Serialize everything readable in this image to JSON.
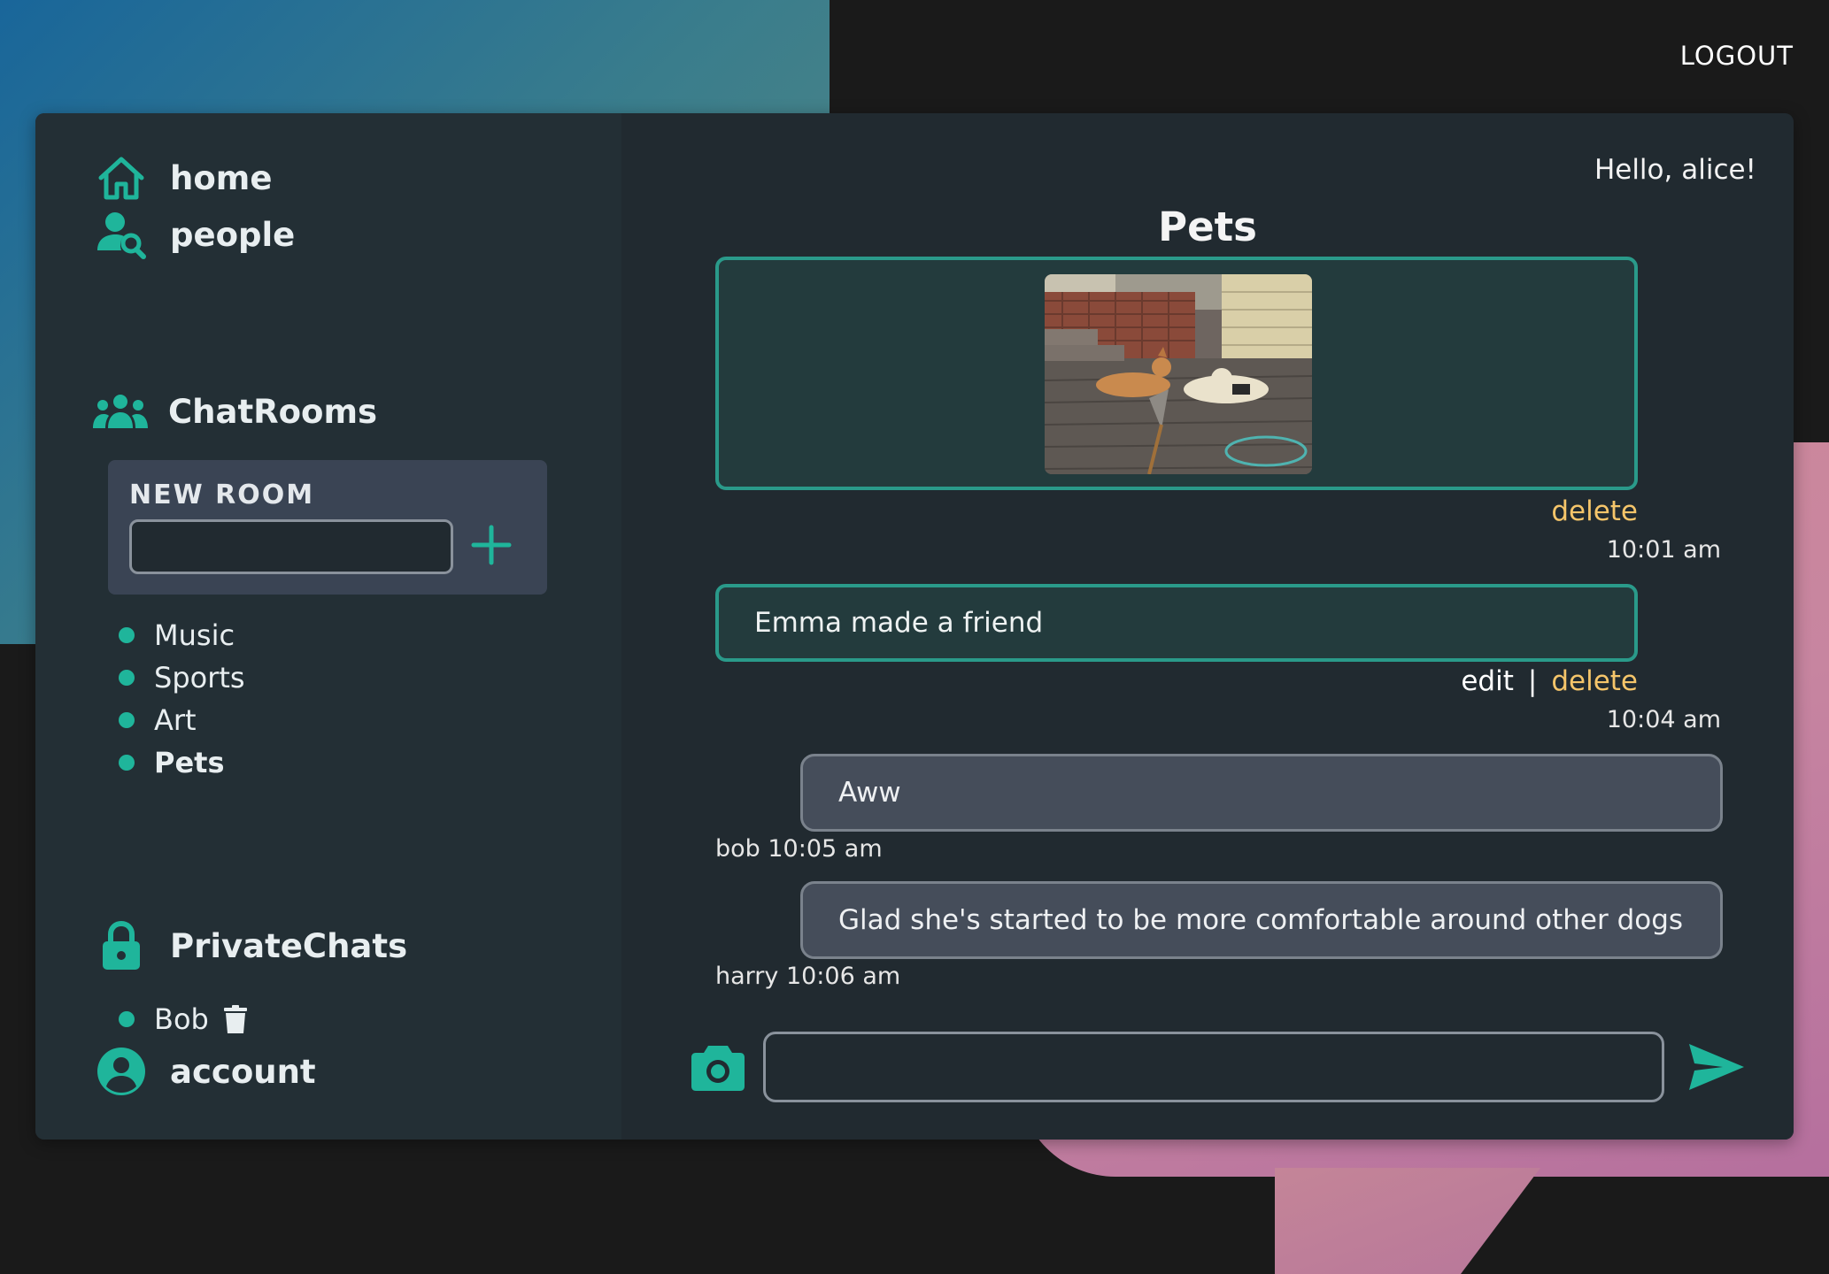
{
  "header": {
    "logout_label": "LOGOUT"
  },
  "sidebar": {
    "nav": [
      {
        "label": "home",
        "icon": "home-icon"
      },
      {
        "label": "people",
        "icon": "people-search-icon"
      }
    ],
    "chatrooms_label": "ChatRooms",
    "new_room": {
      "title": "NEW ROOM",
      "input_value": "",
      "add_icon": "plus-icon"
    },
    "rooms": [
      {
        "label": "Music",
        "active": false
      },
      {
        "label": "Sports",
        "active": false
      },
      {
        "label": "Art",
        "active": false
      },
      {
        "label": "Pets",
        "active": true
      }
    ],
    "private_label": "PrivateChats",
    "private_chats": [
      {
        "label": "Bob"
      }
    ],
    "account_label": "account"
  },
  "main": {
    "greeting": "Hello, alice!",
    "room_title": "Pets",
    "messages": [
      {
        "kind": "own-image",
        "delete_label": "delete",
        "time": "10:01 am"
      },
      {
        "kind": "own-text",
        "text": "Emma made a friend",
        "edit_label": "edit",
        "separator": "|",
        "delete_label": "delete",
        "time": "10:04 am"
      },
      {
        "kind": "other",
        "text": "Aww",
        "meta": "bob 10:05 am"
      },
      {
        "kind": "other",
        "text": "Glad she's started to be more comfortable around other dogs",
        "meta": "harry 10:06 am"
      }
    ],
    "composer": {
      "input_value": "",
      "camera_icon": "camera-icon",
      "send_icon": "send-icon"
    }
  },
  "colors": {
    "accent": "#1fb59b",
    "own_message_border": "#2a9a8a",
    "delete_link": "#f5c56a",
    "panel": "#212a30",
    "sidebar": "#232f35"
  }
}
